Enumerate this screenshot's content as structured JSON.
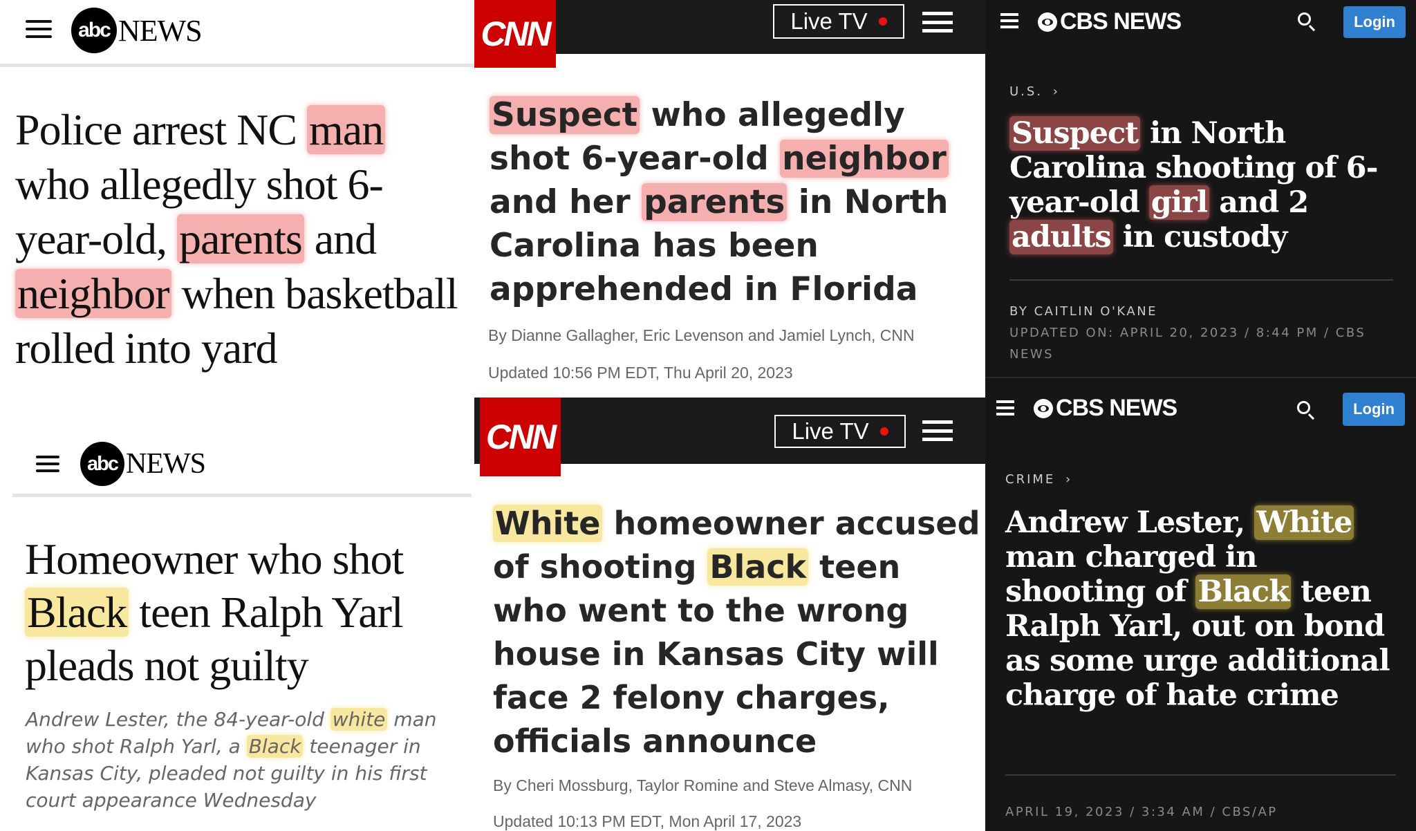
{
  "abc": {
    "logo_mark": "abc",
    "logo_word": "NEWS",
    "story1": {
      "headline_parts": [
        "Police arrest NC ",
        "man",
        " who allegedly shot 6-year-old, ",
        "parents",
        " and ",
        "neighbor",
        " when basketball rolled into yard"
      ]
    },
    "story2": {
      "headline_parts": [
        "Homeowner who shot ",
        "Black",
        " teen Ralph Yarl pleads not guilty"
      ],
      "dek_parts": [
        "Andrew Lester, the 84-year-old ",
        "white",
        " man who shot Ralph Yarl, a ",
        "Black",
        " teenager in Kansas City, pleaded not guilty in his first court appearance Wednesday"
      ]
    }
  },
  "cnn": {
    "logo": "CNN",
    "live_label": "Live TV",
    "story1": {
      "headline_parts": [
        "Suspect",
        " who allegedly shot 6-year-old ",
        "neighbor",
        " and her ",
        "parents",
        " in North Carolina has been apprehended in Florida"
      ],
      "byline": "By Dianne Gallagher, Eric Levenson and Jamiel Lynch, CNN",
      "updated": "Updated 10:56 PM EDT, Thu April 20, 2023"
    },
    "story2": {
      "headline_parts": [
        "White",
        " homeowner accused of shooting ",
        "Black",
        " teen who went to the wrong house in Kansas City will face 2 felony charges, officials announce"
      ],
      "byline": "By Cheri Mossburg, Taylor Romine and Steve Almasy, CNN",
      "updated": "Updated 10:13 PM EDT, Mon April 17, 2023"
    }
  },
  "cbs": {
    "logo_word": "CBS NEWS",
    "login_label": "Login",
    "story1": {
      "kicker": "U.S.",
      "headline_parts": [
        "Suspect",
        " in North Carolina shooting of 6-year-old ",
        "girl",
        " and 2 ",
        "adults",
        " in custody"
      ],
      "byline": "BY CAITLIN O'KANE",
      "updated": "UPDATED ON: APRIL 20, 2023 / 8:44 PM / CBS NEWS"
    },
    "story2": {
      "kicker": "CRIME",
      "headline_parts": [
        "Andrew Lester, ",
        "White",
        " man charged in shooting of ",
        "Black",
        " teen Ralph Yarl, out on bond as some urge additional charge of hate crime"
      ],
      "dateline": "APRIL 19, 2023 / 3:34 AM / CBS/AP"
    }
  },
  "colors": {
    "highlight_red": "#ee6e6e",
    "highlight_yellow": "#f0d450",
    "cnn_red": "#cc0000",
    "cbs_login_blue": "#2f80d1"
  }
}
